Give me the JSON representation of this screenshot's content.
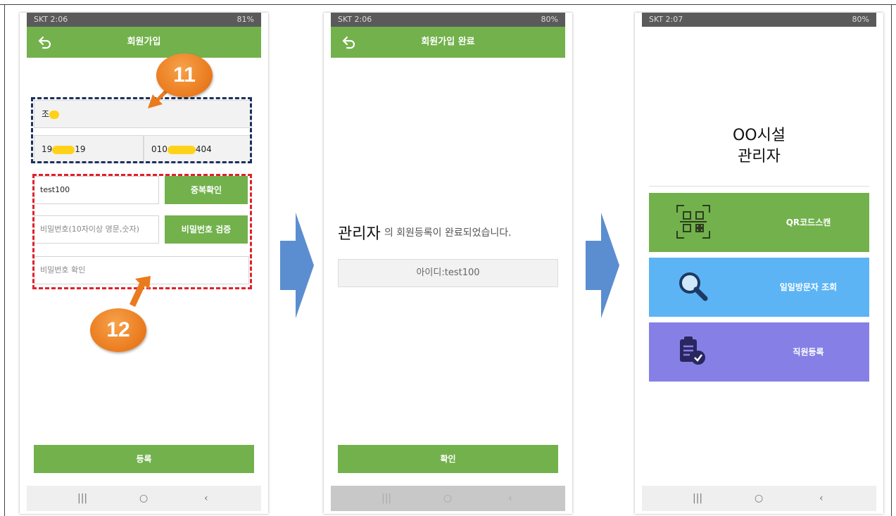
{
  "colors": {
    "green": "#72b14c",
    "blue": "#5cb4f5",
    "purple": "#8680e6",
    "orange": "#ea7a1d",
    "arrow": "#5b8ed0"
  },
  "phone1": {
    "status_left": "SKT 2:06",
    "status_right": "81%",
    "title": "회원가입",
    "name_value": "조",
    "birth_prefix": "19",
    "birth_suffix": "19",
    "phone_prefix": "010",
    "phone_suffix": "404",
    "id_value": "test100",
    "dup_check_label": "중복확인",
    "password_placeholder": "비밀번호(10자이상 영문,숫자)",
    "password_verify_label": "비밀번호 검증",
    "confirm_placeholder": "비밀번호 확인",
    "register_label": "등록",
    "badge_top": "11",
    "badge_bottom": "12"
  },
  "phone2": {
    "status_left": "SKT 2:06",
    "status_right": "80%",
    "title": "회원가입 완료",
    "role_label": "관리자",
    "message": "의 회원등록이 완료되었습니다.",
    "id_display": "아이디:test100",
    "confirm_label": "확인"
  },
  "phone3": {
    "status_left": "SKT 2:07",
    "status_right": "80%",
    "facility_line1": "OO시설",
    "facility_line2": "관리자",
    "menu": [
      {
        "label": "QR코드스캔",
        "icon": "qr-code-icon"
      },
      {
        "label": "일일방문자 조회",
        "icon": "magnifier-icon"
      },
      {
        "label": "직원등록",
        "icon": "clipboard-check-icon"
      }
    ]
  },
  "nav": {
    "recent": "|||",
    "home": "○",
    "back": "‹"
  }
}
